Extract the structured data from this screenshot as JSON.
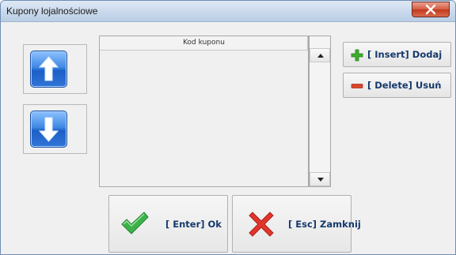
{
  "window": {
    "title": "Kupony lojalnościowe",
    "close_label": "X"
  },
  "grid": {
    "column_header": "Kod kuponu",
    "rows": []
  },
  "buttons": {
    "move_up_icon": "arrow-up-icon",
    "move_down_icon": "arrow-down-icon",
    "insert_label": "[ Insert] Dodaj",
    "delete_label": "[ Delete] Usuń",
    "ok_label": "[ Enter] Ok",
    "cancel_label": "[ Esc] Zamknij"
  },
  "colors": {
    "accent_blue": "#2f76da",
    "plus_green": "#3fae2a",
    "minus_red": "#d9442a",
    "check_green": "#3bb34a",
    "cross_red": "#e2352b",
    "label_navy": "#15396b"
  }
}
